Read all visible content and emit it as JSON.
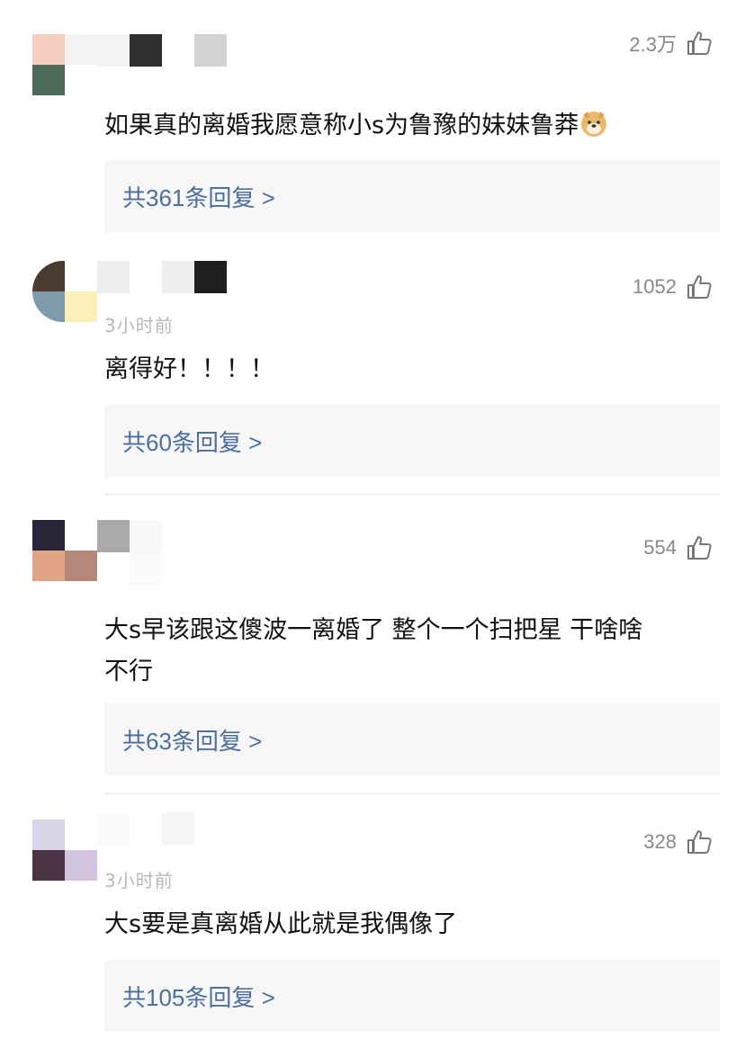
{
  "comments": [
    {
      "likes": "2.3万",
      "time": "",
      "text": "如果真的离婚我愿意称小s为鲁豫的妹妹鲁莽",
      "emoji": "doge-emoji",
      "reply": "共361条回复 >"
    },
    {
      "likes": "1052",
      "time": "3小时前",
      "text": "离得好！！！！",
      "reply": "共60条回复 >"
    },
    {
      "likes": "554",
      "time": "",
      "text_line1": "大s早该跟这傻波一离婚了 整个一个扫把星 干啥啥",
      "text_line2": "不行",
      "reply": "共63条回复 >"
    },
    {
      "likes": "328",
      "time": "3小时前",
      "text": "大s要是真离婚从此就是我偶像了",
      "reply": "共105条回复 >"
    }
  ],
  "colors": {
    "reply_link": "#4a6fa0",
    "reply_bg": "#f7f7f7",
    "like_count": "#888888"
  },
  "icons": [
    "thumbs-up-icon",
    "doge-emoji"
  ]
}
